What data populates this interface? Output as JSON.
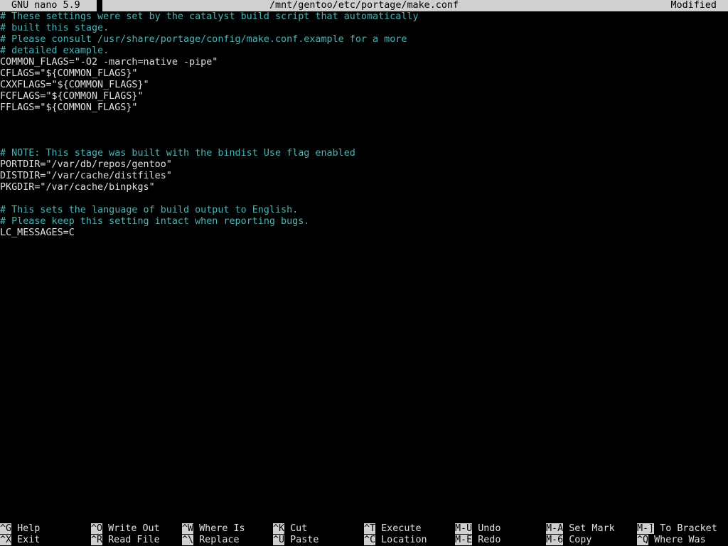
{
  "titlebar": {
    "version": "GNU nano 5.9",
    "filename": "/mnt/gentoo/etc/portage/make.conf",
    "state": "Modified"
  },
  "editor": {
    "lines": [
      {
        "text": "# These settings were set by the catalyst build script that automatically",
        "type": "comment"
      },
      {
        "text": "# built this stage.",
        "type": "comment"
      },
      {
        "text": "# Please consult /usr/share/portage/config/make.conf.example for a more",
        "type": "comment"
      },
      {
        "text": "# detailed example.",
        "type": "comment"
      },
      {
        "text": "COMMON_FLAGS=\"-O2 -march=native -pipe\"",
        "type": "code"
      },
      {
        "text": "CFLAGS=\"${COMMON_FLAGS}\"",
        "type": "code"
      },
      {
        "text": "CXXFLAGS=\"${COMMON_FLAGS}\"",
        "type": "code"
      },
      {
        "text": "FCFLAGS=\"${COMMON_FLAGS}\"",
        "type": "code"
      },
      {
        "text": "FFLAGS=\"${COMMON_FLAGS}\"",
        "type": "code"
      },
      {
        "text": "",
        "type": "code"
      },
      {
        "text": "",
        "type": "code"
      },
      {
        "text": "",
        "type": "code"
      },
      {
        "text": "# NOTE: This stage was built with the bindist Use flag enabled",
        "type": "comment"
      },
      {
        "text": "PORTDIR=\"/var/db/repos/gentoo\"",
        "type": "code"
      },
      {
        "text": "DISTDIR=\"/var/cache/distfiles\"",
        "type": "code"
      },
      {
        "text": "PKGDIR=\"/var/cache/binpkgs\"",
        "type": "code"
      },
      {
        "text": "",
        "type": "code"
      },
      {
        "text": "# This sets the language of build output to English.",
        "type": "comment"
      },
      {
        "text": "# Please keep this setting intact when reporting bugs.",
        "type": "comment"
      },
      {
        "text": "LC_MESSAGES=C",
        "type": "code"
      }
    ]
  },
  "shortcuts": {
    "row1": [
      {
        "key": "^G",
        "label": "Help"
      },
      {
        "key": "^O",
        "label": "Write Out"
      },
      {
        "key": "^W",
        "label": "Where Is"
      },
      {
        "key": "^K",
        "label": "Cut"
      },
      {
        "key": "^T",
        "label": "Execute"
      },
      {
        "key": "M-U",
        "label": "Undo"
      },
      {
        "key": "M-A",
        "label": "Set Mark"
      },
      {
        "key": "M-]",
        "label": "To Bracket"
      }
    ],
    "row2": [
      {
        "key": "^X",
        "label": "Exit"
      },
      {
        "key": "^R",
        "label": "Read File"
      },
      {
        "key": "^\\",
        "label": "Replace"
      },
      {
        "key": "^U",
        "label": "Paste"
      },
      {
        "key": "^C",
        "label": "Location"
      },
      {
        "key": "M-E",
        "label": "Redo"
      },
      {
        "key": "M-6",
        "label": "Copy"
      },
      {
        "key": "^Q",
        "label": "Where Was"
      }
    ]
  },
  "colors": {
    "background": "#000000",
    "text": "#e0e0e0",
    "comment": "#4fb3b3",
    "inverse_bg": "#d0d0d0"
  }
}
